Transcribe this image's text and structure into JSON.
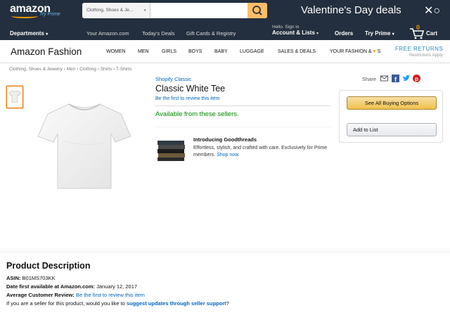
{
  "header": {
    "logo_text": "amazon",
    "logo_sub": "Try Prime",
    "search_category": "Clothing, Shoes & Je...",
    "search_value": "",
    "promo": "Valentine's Day deals"
  },
  "nav": {
    "departments": "Departments",
    "your_amazon": "Your Amazon.com",
    "todays_deals": "Today's Deals",
    "gift_cards": "Gift Cards & Registry",
    "hello": "Hello. Sign in",
    "account_lists": "Account & Lists",
    "orders": "Orders",
    "try_prime": "Try Prime",
    "cart_count": "0",
    "cart": "Cart"
  },
  "fashion": {
    "title": "Amazon Fashion",
    "items": [
      "WOMEN",
      "MEN",
      "GIRLS",
      "BOYS",
      "BABY",
      "LUGGAGE",
      "SALES & DEALS",
      "YOUR FASHION &",
      "S"
    ],
    "free_returns": "FREE RETURNS",
    "restrictions": "Restrictions Apply"
  },
  "breadcrumb": "Clothing, Shoes & Jewelry › Men › Clothing › Shirts › T-Shirts",
  "product": {
    "brand": "Shopify Classic",
    "title": "Classic White Tee",
    "review_link": "Be the first to review this item",
    "availability": "Available from these sellers."
  },
  "goodthreads": {
    "title": "Introducing Goodthreads",
    "text": "Effortless, stylish, and crafted with care. Exclusively for Prime members.",
    "link": "Shop now."
  },
  "share": {
    "label": "Share"
  },
  "buybox": {
    "buy_button": "See All Buying Options",
    "list_button": "Add to List"
  },
  "description": {
    "title": "Product Description",
    "asin_label": "ASIN:",
    "asin": "B01MS703KK",
    "date_label": "Date first available at Amazon.com:",
    "date": "January 12, 2017",
    "review_label": "Average Customer Review:",
    "review_link": "Be the first to review this item",
    "seller_prefix": "If you are a seller for this product, would you like to",
    "seller_link": "suggest updates through seller support",
    "seller_suffix": "?"
  },
  "colors": {
    "nav_bg": "#232f3e",
    "accent": "#febd69",
    "link": "#0066c0",
    "available": "#008a00",
    "buy_button": "#f0c14b"
  }
}
